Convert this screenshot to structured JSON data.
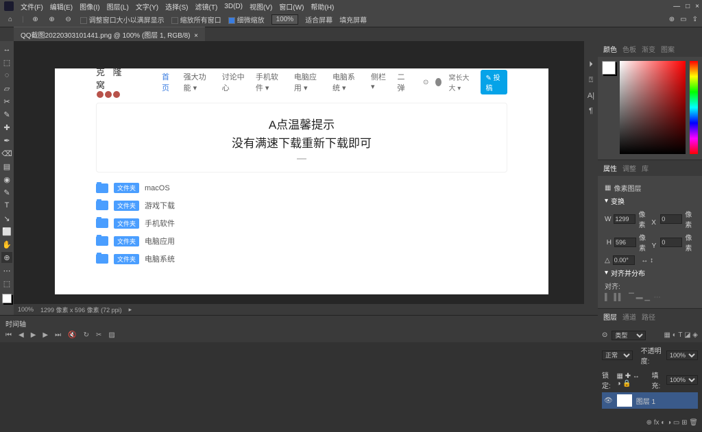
{
  "menu": {
    "items": [
      "文件(F)",
      "编辑(E)",
      "图像(I)",
      "图层(L)",
      "文字(Y)",
      "选择(S)",
      "滤镜(T)",
      "3D(D)",
      "视图(V)",
      "窗口(W)",
      "帮助(H)"
    ],
    "win": [
      "—",
      "□",
      "×"
    ]
  },
  "opt": {
    "fit_label": "调整窗口大小以满屏显示",
    "all_win": "缩放所有窗口",
    "scrub": "细微缩放",
    "zoom": "100%",
    "fit_screen": "适合屏幕",
    "fill_screen": "填充屏幕"
  },
  "tab": {
    "title": "QQ截图20220303101441.png @ 100% (图层 1, RGB/8)"
  },
  "tools": [
    "↔",
    "⬚",
    "◌",
    "▱",
    "✂",
    "✎",
    "✚",
    "✒",
    "⌫",
    "▤",
    "◉",
    "✎",
    "T",
    "↘",
    "⬜",
    "✋",
    "⊕",
    "⋯",
    "⬚"
  ],
  "dock": [
    "⏵",
    "⍰",
    "A|",
    "¶"
  ],
  "doc": {
    "logo_text": "克 隆 窝",
    "nav": [
      "首页",
      "强大功能 ▾",
      "讨论中心",
      "手机软件 ▾",
      "电脑应用 ▾",
      "电脑系统 ▾",
      "侧栏 ▾",
      "二弹"
    ],
    "user": "窝长大大 ▾",
    "post_btn": "✎ 投稿",
    "banner_l1": "A点温馨提示",
    "banner_l2": "没有满速下载重新下载即可",
    "tag": "文件夹",
    "folders": [
      "macOS",
      "游戏下载",
      "手机软件",
      "电脑应用",
      "电脑系统"
    ]
  },
  "status": {
    "zoom": "100%",
    "info": "1299 像素 x 596 像素 (72 ppi)"
  },
  "color": {
    "tabs": [
      "颜色",
      "色板",
      "渐变",
      "图案"
    ]
  },
  "props": {
    "tabs": [
      "属性",
      "调整",
      "库"
    ],
    "title": "像素图层",
    "sec_transform": "变换",
    "w": "1299",
    "w_unit": "像素",
    "x": "0",
    "x_unit": "像素",
    "h": "596",
    "h_unit": "像素",
    "y": "0",
    "y_unit": "像素",
    "angle": "0.00°",
    "sec_align": "对齐并分布",
    "align_label": "对齐:"
  },
  "layers": {
    "tabs": [
      "图层",
      "通道",
      "路径"
    ],
    "kind": "类型",
    "mode": "正常",
    "opacity_label": "不透明度:",
    "opacity": "100%",
    "lock": "锁定:",
    "fill_label": "填充:",
    "fill": "100%",
    "layer1": "图层 1"
  },
  "timeline": {
    "title": "时间轴"
  }
}
